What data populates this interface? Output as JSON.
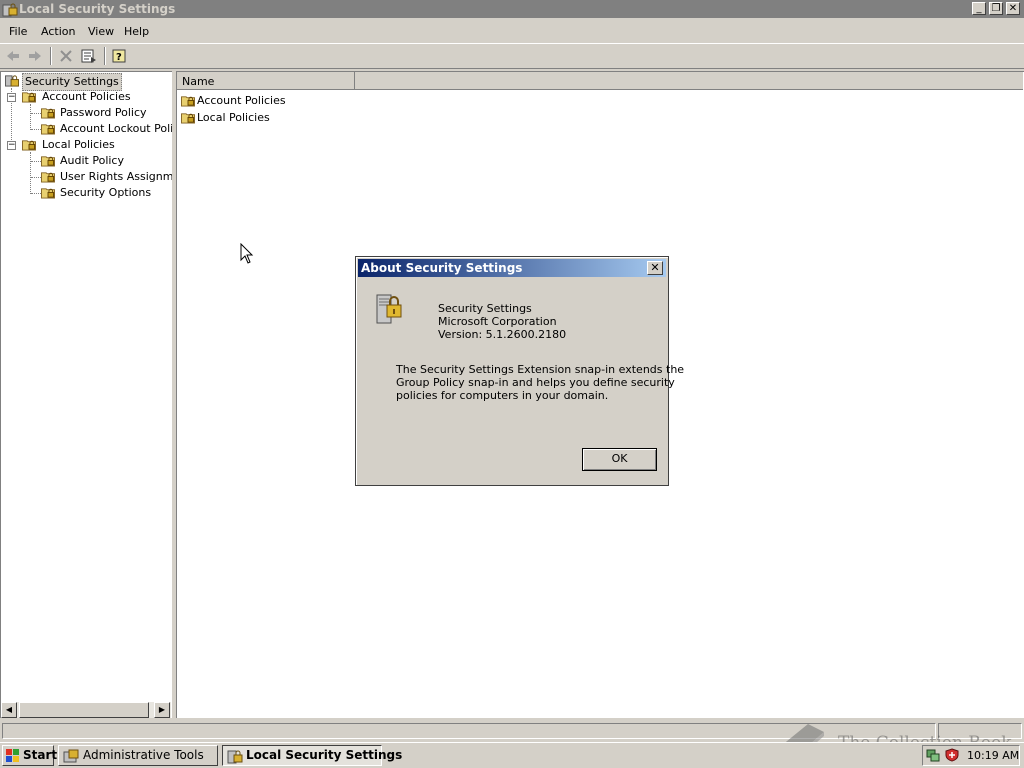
{
  "window": {
    "title": "Local Security Settings",
    "controls": {
      "minimize": "_",
      "restore": "❐",
      "close": "✕"
    }
  },
  "menu": [
    "File",
    "Action",
    "View",
    "Help"
  ],
  "toolbar": [
    "back-icon",
    "forward-icon",
    "delete-icon",
    "export-list-icon",
    "help-icon"
  ],
  "tree": {
    "root": "Security Settings",
    "account_policies": "Account Policies",
    "password_policy": "Password Policy",
    "account_lockout_policy": "Account Lockout Policy",
    "local_policies": "Local Policies",
    "audit_policy": "Audit Policy",
    "user_rights": "User Rights Assignmen",
    "security_options": "Security Options"
  },
  "list": {
    "column_name": "Name",
    "rows": [
      "Account Policies",
      "Local Policies"
    ]
  },
  "dialog": {
    "title": "About Security Settings",
    "product": "Security Settings",
    "company": "Microsoft Corporation",
    "version": "Version: 5.1.2600.2180",
    "description_lines": [
      "The Security Settings Extension snap-in extends the",
      "Group Policy snap-in and helps you define security",
      "policies for computers in your domain."
    ],
    "ok_label": "OK"
  },
  "taskbar": {
    "start_label": "Start",
    "tasks": [
      "Administrative Tools",
      "Local Security Settings"
    ],
    "clock": "10:19 AM"
  },
  "watermark": "The Collection Book",
  "colors": {
    "dialog_title_start": "#0a246a",
    "dialog_title_end": "#a6caf0",
    "inactive_title": "#808080",
    "face": "#d4d0c8"
  }
}
